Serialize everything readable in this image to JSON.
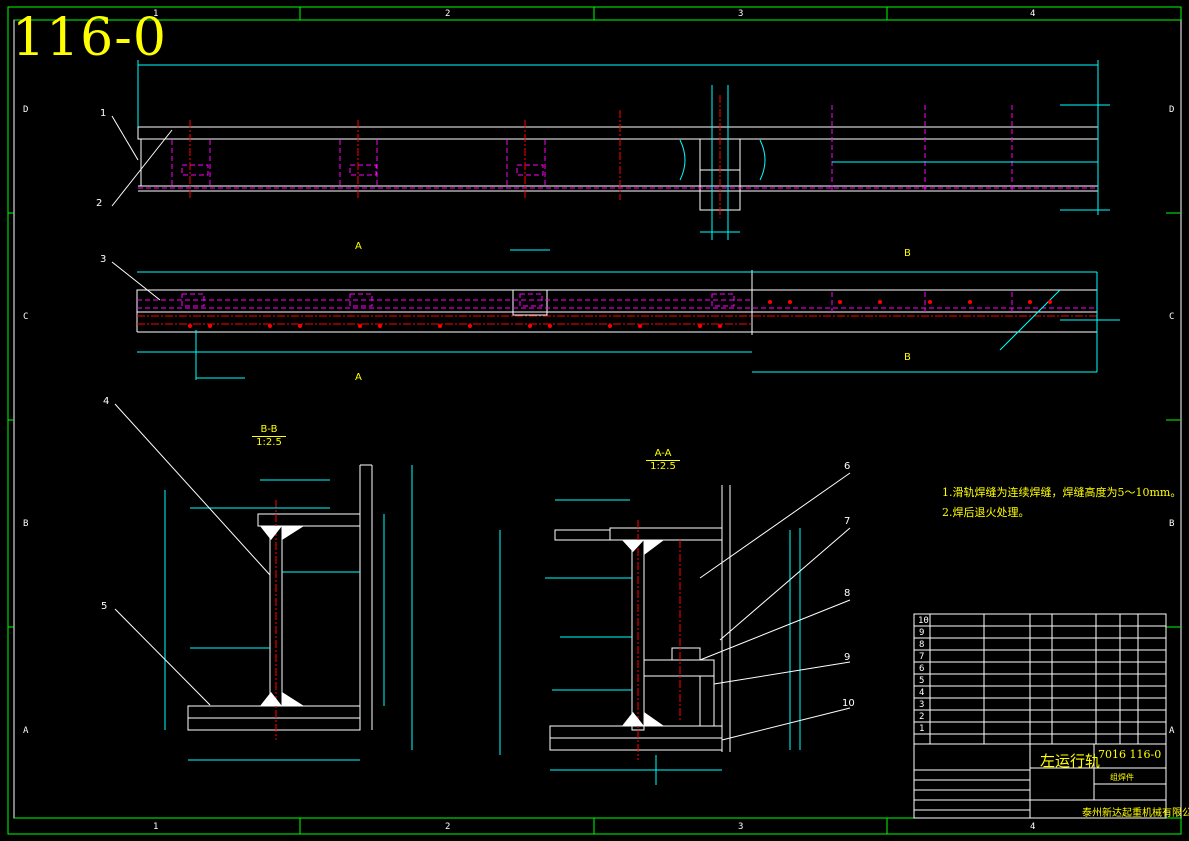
{
  "drawing": {
    "number_big": "116-0",
    "notes": [
      "1.滑轨焊缝为连续焊缝，焊缝高度为5～10mm。",
      "2.焊后退火处理。"
    ],
    "section_labels": {
      "bb_title": "B-B",
      "bb_scale": "1:2.5",
      "aa_title": "A-A",
      "aa_scale": "1:2.5"
    },
    "section_marks": [
      "A",
      "A",
      "B",
      "B"
    ],
    "callouts": [
      "1",
      "2",
      "3",
      "4",
      "5",
      "6",
      "7",
      "8",
      "9",
      "10"
    ],
    "grid_columns": [
      "1",
      "2",
      "3",
      "4"
    ],
    "grid_rows": [
      "D",
      "C",
      "B",
      "A"
    ]
  },
  "title_block": {
    "part_name": "左运行轨",
    "drawing_code": "7016 116-0",
    "sub_label": "组焊件",
    "company": "泰州新达起重机械有限公司",
    "bom_rows": [
      "10",
      "9",
      "8",
      "7",
      "6",
      "5",
      "4",
      "3",
      "2",
      "1"
    ]
  },
  "colors": {
    "background": "#000000",
    "outline": "#ffffff",
    "dimension": "#00ffff",
    "hidden": "#ff00ff",
    "center": "#ff0000",
    "frame": "#00ff00",
    "text": "#ffff00"
  }
}
